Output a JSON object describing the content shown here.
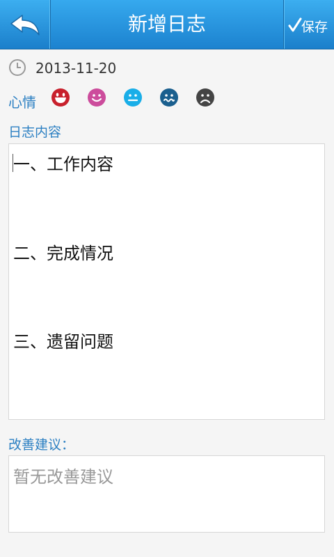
{
  "header": {
    "title": "新增日志",
    "save_label": "保存"
  },
  "icons": {
    "back": "back-arrow-icon",
    "check": "check-icon",
    "clock": "clock-icon"
  },
  "date": "2013-11-20",
  "mood": {
    "label": "心情",
    "faces": [
      {
        "name": "laughing-face-icon",
        "color": "#c8202c"
      },
      {
        "name": "smiling-face-icon",
        "color": "#cc4c9c"
      },
      {
        "name": "neutral-face-icon",
        "color": "#19aee8"
      },
      {
        "name": "wavy-mouth-face-icon",
        "color": "#1a5f8e"
      },
      {
        "name": "sad-face-icon",
        "color": "#444444"
      }
    ]
  },
  "content": {
    "label": "日志内容",
    "lines": [
      "一、工作内容",
      "二、完成情况",
      "三、遗留问题"
    ]
  },
  "suggestion": {
    "label": "改善建议：",
    "placeholder": "暂无改善建议"
  },
  "colors": {
    "accent": "#2b7fc2",
    "header": "#2a97e0"
  }
}
